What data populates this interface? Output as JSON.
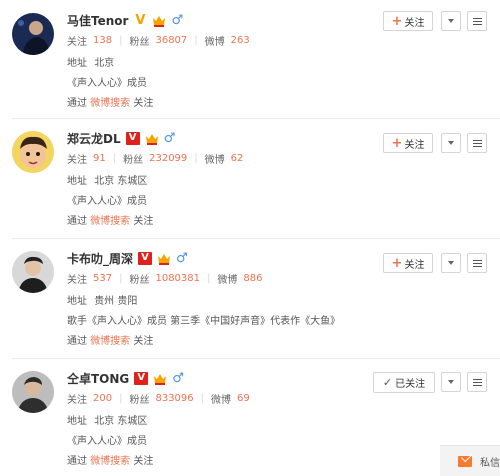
{
  "labels": {
    "follow": "关注",
    "followed": "已关注",
    "stat_follow": "关注",
    "stat_fans": "粉丝",
    "stat_weibo": "微博",
    "addr_prefix": "地址",
    "via_prefix": "通过",
    "via_source": "微博搜索",
    "via_suffix": "关注"
  },
  "users": [
    {
      "name": "马佳Tenor",
      "verified": "gold",
      "follow_count": "138",
      "fans_count": "36807",
      "weibo_count": "263",
      "address": "北京",
      "desc": "《声入人心》成员",
      "followed": false
    },
    {
      "name": "郑云龙DL",
      "verified": "red",
      "follow_count": "91",
      "fans_count": "232099",
      "weibo_count": "62",
      "address": "北京 东城区",
      "desc": "《声入人心》成员",
      "followed": false
    },
    {
      "name": "卡布叻_周深",
      "verified": "red",
      "follow_count": "537",
      "fans_count": "1080381",
      "weibo_count": "886",
      "address": "贵州 贵阳",
      "desc": "歌手《声入人心》成员 第三季《中国好声音》代表作《大鱼》",
      "followed": false
    },
    {
      "name": "仝卓TONG",
      "verified": "red",
      "follow_count": "200",
      "fans_count": "833096",
      "weibo_count": "69",
      "address": "北京 东城区",
      "desc": "《声入人心》成员",
      "followed": true
    }
  ],
  "message_bar": {
    "label": "私信"
  },
  "colors": {
    "accent": "#eb7350",
    "verified_red": "#e0201a",
    "verified_gold": "#f6a400",
    "gender_blue": "#4a90e2"
  }
}
